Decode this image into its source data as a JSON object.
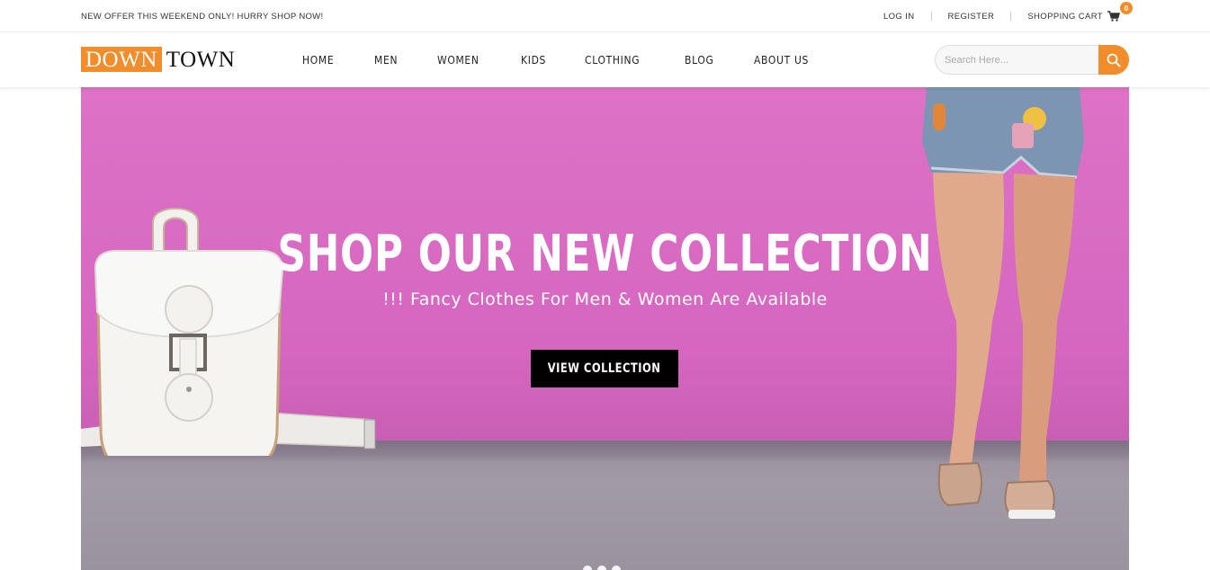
{
  "topbar": {
    "offer": "NEW OFFER THIS WEEKEND ONLY! HURRY SHOP NOW!",
    "login": "LOG IN",
    "register": "REGISTER",
    "cart_label": "SHOPPING CART",
    "cart_count": "0"
  },
  "brand": {
    "part1": "DOWN",
    "part2": "TOWN",
    "accent_color": "#f18d2a"
  },
  "nav": {
    "items": [
      "HOME",
      "MEN",
      "WOMEN",
      "KIDS",
      "CLOTHING",
      "BLOG",
      "ABOUT US"
    ]
  },
  "search": {
    "placeholder": "Search Here..."
  },
  "hero": {
    "title": "SHOP OUR NEW COLLECTION",
    "subtitle": "!!! Fancy Clothes For Men & Women Are Available",
    "button": "VIEW COLLECTION",
    "slides": 3
  },
  "icons": [
    "cart-icon",
    "search-icon"
  ]
}
